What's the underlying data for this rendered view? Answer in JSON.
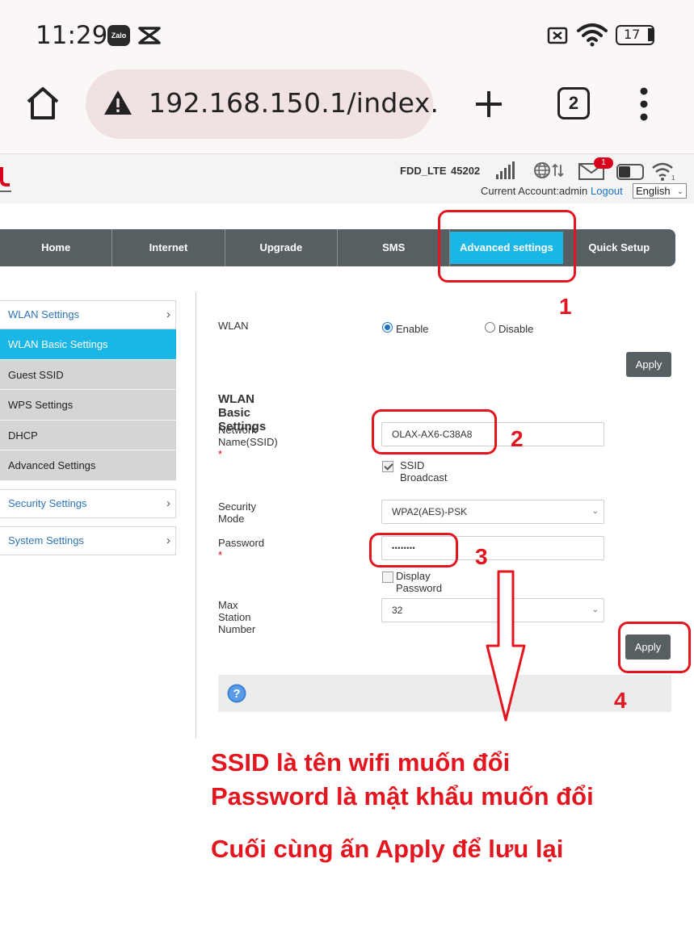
{
  "status_bar": {
    "time": "11:29",
    "zalo_icon_text": "Zalo",
    "battery": "17"
  },
  "browser": {
    "url": "192.168.150.1/index.",
    "tab_count": "2"
  },
  "router_header": {
    "network_type": "FDD_LTE",
    "plmn": "45202",
    "mail_badge": "1",
    "account_label": "Current Account:admin",
    "logout_label": "Logout",
    "language": "English"
  },
  "nav": {
    "tabs": [
      "Home",
      "Internet",
      "Upgrade",
      "SMS",
      "Advanced settings",
      "Quick Setup"
    ],
    "active": "Advanced settings"
  },
  "sidebar": {
    "wlan_group": "WLAN Settings",
    "items": [
      "WLAN Basic Settings",
      "Guest SSID",
      "WPS Settings",
      "DHCP",
      "Advanced Settings"
    ],
    "security_group": "Security Settings",
    "system_group": "System Settings"
  },
  "wlan": {
    "label": "WLAN",
    "enable_label": "Enable",
    "disable_label": "Disable",
    "selected": "Enable",
    "apply_label": "Apply"
  },
  "basic": {
    "title": "WLAN Basic Settings",
    "ssid_label": "Network Name(SSID)",
    "ssid_value": "OLAX-AX6-C38A8",
    "ssid_broadcast_label": "SSID Broadcast",
    "ssid_broadcast_checked": true,
    "security_mode_label": "Security Mode",
    "security_mode_value": "WPA2(AES)-PSK",
    "password_label": "Password",
    "password_value": "••••••••",
    "display_password_label": "Display Password",
    "display_password_checked": false,
    "max_station_label": "Max Station Number",
    "max_station_value": "32",
    "required_mark": "*",
    "apply_label": "Apply"
  },
  "annotations": {
    "step1": "1",
    "step2": "2",
    "step3": "3",
    "step4": "4",
    "caption_line1": "SSID là tên wifi muốn đổi",
    "caption_line2": "Password là mật khẩu muốn đổi",
    "caption_line3": "Cuối cùng ấn Apply để lưu lại",
    "annotation_color": "#e3161f"
  },
  "colors": {
    "nav_bg": "#585f62",
    "active_tab": "#1ab7e6",
    "link": "#1a73c7"
  }
}
